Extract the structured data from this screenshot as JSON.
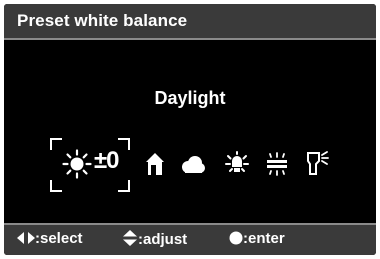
{
  "header": {
    "title": "Preset white balance"
  },
  "selection": {
    "mode_label": "Daylight",
    "adjust_value": "±0"
  },
  "presets": [
    {
      "name": "daylight",
      "icon": "sun-icon",
      "selected": true
    },
    {
      "name": "shade",
      "icon": "house-shade-icon"
    },
    {
      "name": "cloudy",
      "icon": "cloud-icon"
    },
    {
      "name": "tungsten",
      "icon": "light-bulb-icon"
    },
    {
      "name": "fluorescent",
      "icon": "fluorescent-icon"
    },
    {
      "name": "flash",
      "icon": "flash-icon"
    }
  ],
  "footer": {
    "select_label": ":select",
    "adjust_label": ":adjust",
    "enter_label": ":enter"
  },
  "colors": {
    "background": "#000000",
    "bar": "#3a3a3a",
    "text": "#ffffff",
    "rule": "#8a8a8a"
  }
}
